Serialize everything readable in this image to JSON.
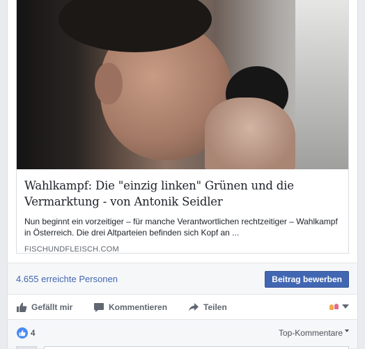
{
  "link_preview": {
    "headline": "Wahlkampf: Die \"einzig linken\" Grünen und die Vermarktung - von Antonik Seidler",
    "excerpt": "Nun beginnt ein vorzeitiger – für manche Verantwortlichen rechtzeitiger – Wahlkampf in Österreich. Die drei Altparteien befinden sich Kopf an ...",
    "domain": "FISCHUNDFLEISCH.COM"
  },
  "reach": {
    "text": "4.655 erreichte Personen",
    "boost_label": "Beitrag bewerben"
  },
  "actions": {
    "like_label": "Gefällt mir",
    "comment_label": "Kommentieren",
    "share_label": "Teilen"
  },
  "comments_bar": {
    "like_count": "4",
    "sort_label": "Top-Kommentare"
  },
  "colors": {
    "link_blue": "#4267b2",
    "like_blue": "#4a8af4",
    "muted_text": "#606770",
    "panel_bg": "#f6f7f9"
  },
  "icons": [
    "thumbs-up-icon",
    "comment-bubble-icon",
    "share-arrow-icon",
    "audience-avatar-icon",
    "chevron-down-icon",
    "like-reaction-icon"
  ]
}
